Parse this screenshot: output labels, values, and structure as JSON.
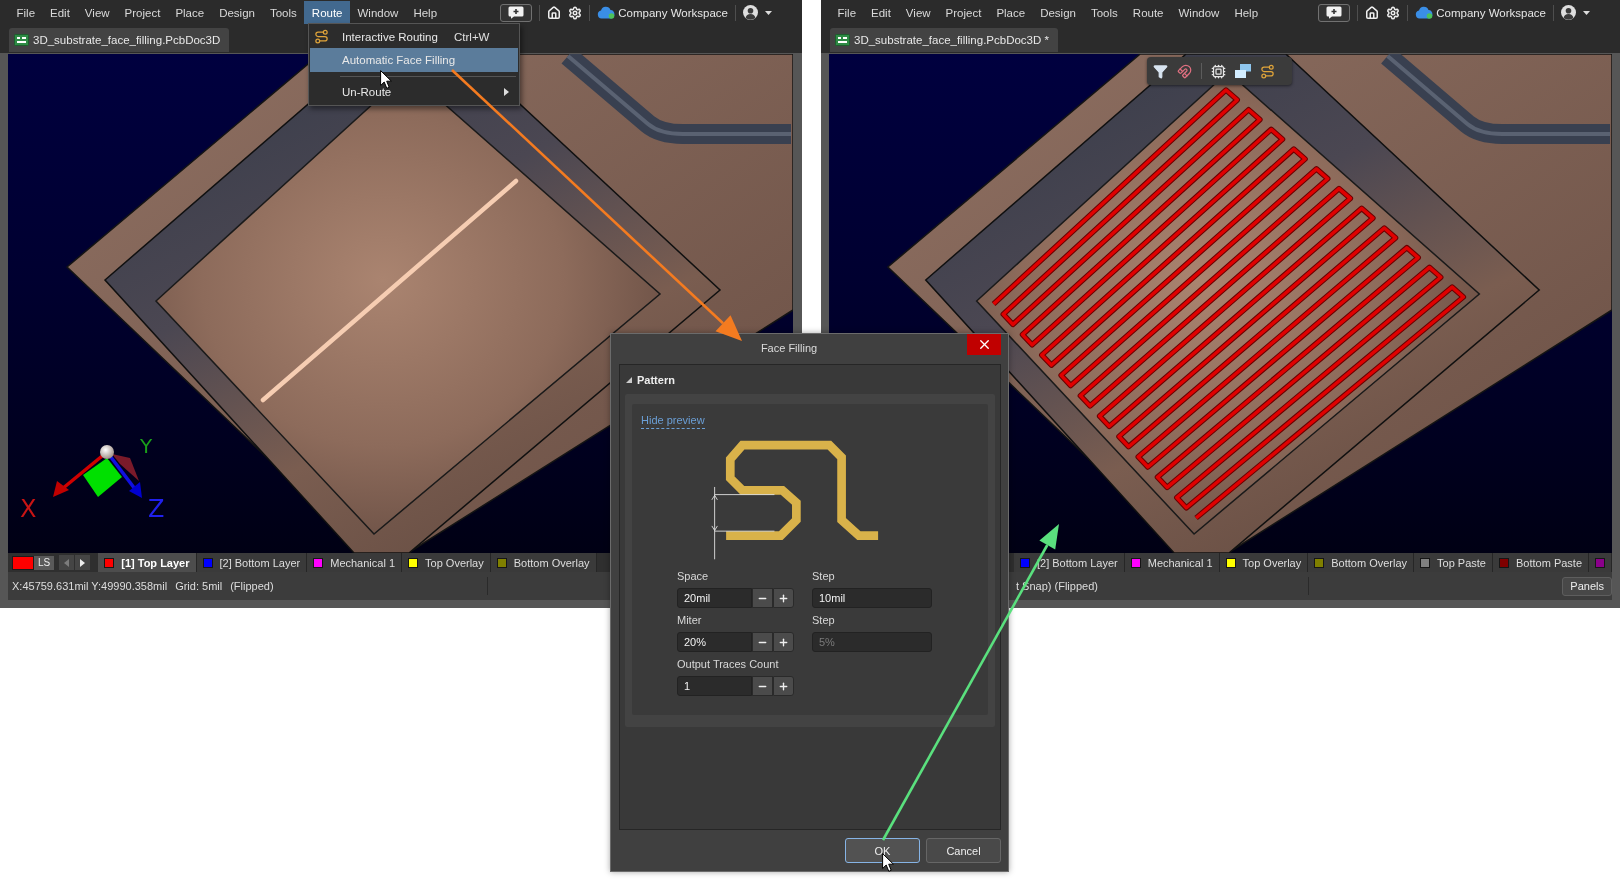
{
  "windows": [
    {
      "menu": [
        {
          "label": "File",
          "selected": false
        },
        {
          "label": "Edit",
          "selected": false
        },
        {
          "label": "View",
          "selected": false
        },
        {
          "label": "Project",
          "selected": false
        },
        {
          "label": "Place",
          "selected": false
        },
        {
          "label": "Design",
          "selected": false
        },
        {
          "label": "Tools",
          "selected": false
        },
        {
          "label": "Route",
          "selected": true
        },
        {
          "label": "Window",
          "selected": false
        },
        {
          "label": "Help",
          "selected": false
        }
      ],
      "workspace": "Company Workspace",
      "document_tab": "3D_substrate_face_filling.PcbDoc3D",
      "open_menu": {
        "items": [
          {
            "kind": "tool",
            "label": "Interactive Routing",
            "shortcut": "Ctrl+W",
            "selected": false
          },
          {
            "kind": "command",
            "label": "Automatic Face Filling",
            "selected": true
          },
          {
            "kind": "separator"
          },
          {
            "kind": "submenu",
            "label": "Un-Route",
            "selected": false
          }
        ]
      },
      "viewport": {
        "kind": "straight",
        "axis_labels": [
          "X",
          "Y",
          "Z"
        ]
      },
      "layer_bar": {
        "current_layer": {
          "color": "#ff0000"
        },
        "ls_button": "LS",
        "tabs": [
          {
            "label": "[1] Top Layer",
            "color": "#ff0000",
            "selected": true
          },
          {
            "label": "[2] Bottom Layer",
            "color": "#0000ff",
            "selected": false
          },
          {
            "label": "Mechanical 1",
            "color": "#ff00ff",
            "selected": false
          },
          {
            "label": "Top Overlay",
            "color": "#ffff00",
            "selected": false
          },
          {
            "label": "Bottom Overlay",
            "color": "#808000",
            "selected": false
          }
        ]
      },
      "status_bar": {
        "items": [
          "X:45759.631mil Y:49990.358mil",
          "Grid: 5mil",
          "(Flipped)"
        ]
      }
    },
    {
      "menu": [
        {
          "label": "File",
          "selected": false
        },
        {
          "label": "Edit",
          "selected": false
        },
        {
          "label": "View",
          "selected": false
        },
        {
          "label": "Project",
          "selected": false
        },
        {
          "label": "Place",
          "selected": false
        },
        {
          "label": "Design",
          "selected": false
        },
        {
          "label": "Tools",
          "selected": false
        },
        {
          "label": "Route",
          "selected": false
        },
        {
          "label": "Window",
          "selected": false
        },
        {
          "label": "Help",
          "selected": false
        }
      ],
      "workspace": "Company Workspace",
      "document_tab": "3D_substrate_face_filling.PcbDoc3D *",
      "viewport": {
        "kind": "serpentine",
        "floating_toolbar": true
      },
      "layer_bar": {
        "tabs": [
          {
            "label": "[2] Bottom Layer",
            "color": "#0000ff",
            "selected": false
          },
          {
            "label": "Mechanical 1",
            "color": "#ff00ff",
            "selected": false
          },
          {
            "label": "Top Overlay",
            "color": "#ffff00",
            "selected": false
          },
          {
            "label": "Bottom Overlay",
            "color": "#808000",
            "selected": false
          },
          {
            "label": "Top Paste",
            "color": "#808080",
            "selected": false
          },
          {
            "label": "Bottom Paste",
            "color": "#800000",
            "selected": false
          },
          {
            "color": "#8b008b",
            "selected": false
          }
        ]
      },
      "status_bar": {
        "items": [
          "t Snap) (Flipped)"
        ],
        "panels_button": "Panels"
      }
    }
  ],
  "dialog": {
    "title": "Face Filling",
    "section": {
      "title": "Pattern",
      "expanded": true,
      "preview_link": "Hide preview",
      "fields": [
        {
          "kind": "spinner",
          "label": "Space",
          "value": "20mil",
          "disabled": false
        },
        {
          "kind": "text",
          "label": "Step",
          "value": "10mil",
          "disabled": false
        },
        {
          "kind": "spinner",
          "label": "Miter",
          "value": "20%",
          "disabled": false
        },
        {
          "kind": "text",
          "label": "Step",
          "value": "5%",
          "disabled": true
        },
        {
          "kind": "spinner",
          "label": "Output Traces Count",
          "value": "1",
          "disabled": false
        }
      ]
    },
    "buttons": [
      {
        "label": "OK",
        "focused": true
      },
      {
        "label": "Cancel",
        "focused": false
      }
    ]
  },
  "callout_arrows": [
    {
      "color": "#f47b20"
    },
    {
      "color": "#5ae07e"
    }
  ]
}
